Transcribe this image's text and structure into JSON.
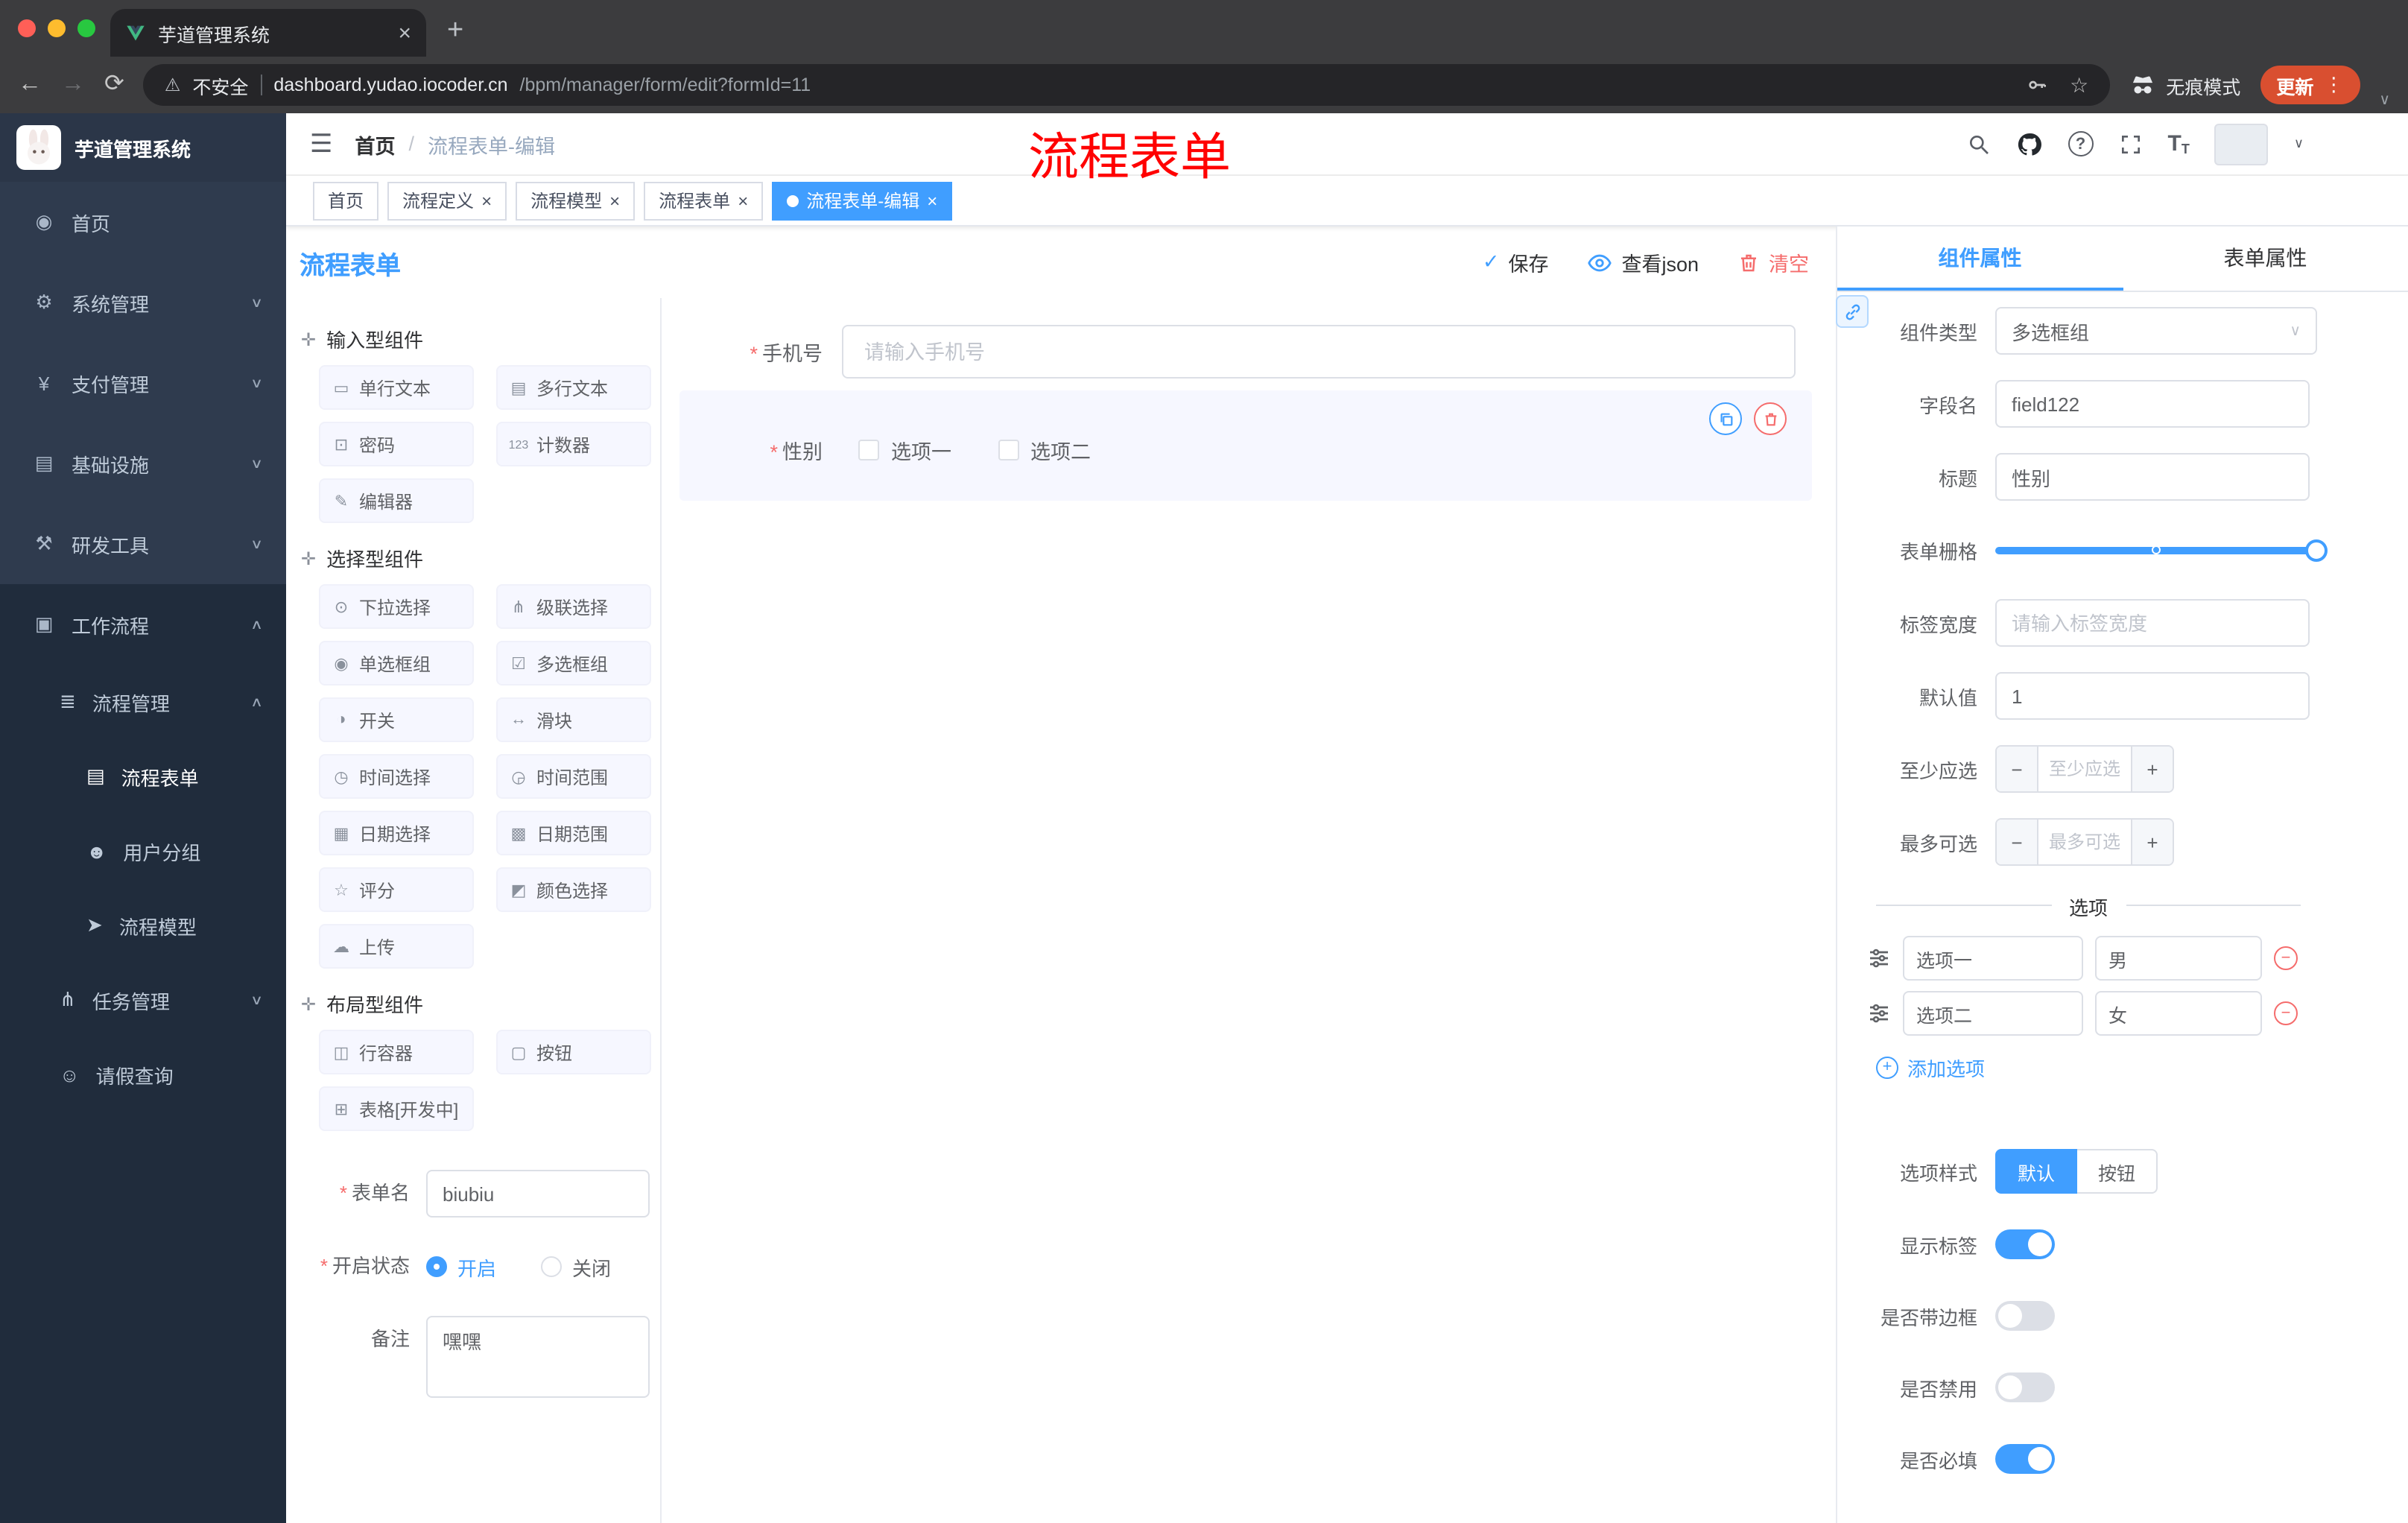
{
  "colors": {
    "primary": "#409eff",
    "danger": "#f56c6c",
    "sidebar_bg": "#2f3b4e",
    "sidebar_submenu_bg": "#202c3c",
    "update_pill": "#d94f30",
    "annotation": "#ff0000"
  },
  "icons": {
    "close": "×",
    "new_tab": "+",
    "back": "←",
    "forward": "→",
    "reload": "⟳",
    "warning": "⚠",
    "star": "☆",
    "kebab": "⋮",
    "caret_down": "∨",
    "chevron_up": "∧",
    "chevron_down": "∨",
    "hamburger": "☰",
    "slash": "/",
    "question": "?",
    "check": "✓",
    "minus": "−",
    "plus": "+",
    "asterisk": "*",
    "font_size": "T"
  },
  "browser": {
    "tab_title": "芋道管理系统",
    "security_label": "不安全",
    "url_host": "dashboard.yudao.iocoder.cn",
    "url_path": "/bpm/manager/form/edit?formId=11",
    "incognito_label": "无痕模式",
    "update_label": "更新"
  },
  "annotation": {
    "text": "流程表单"
  },
  "sidebar": {
    "logo_title": "芋道管理系统",
    "items": [
      {
        "label": "首页",
        "glyph": "◉"
      },
      {
        "label": "系统管理",
        "glyph": "⚙"
      },
      {
        "label": "支付管理",
        "glyph": "¥"
      },
      {
        "label": "基础设施",
        "glyph": "▤"
      },
      {
        "label": "研发工具",
        "glyph": "⚒"
      }
    ],
    "workflow": {
      "label": "工作流程",
      "glyph": "▣",
      "submenu": [
        {
          "label": "流程管理",
          "glyph": "≣"
        },
        {
          "label": "流程表单",
          "glyph": "▤"
        },
        {
          "label": "用户分组",
          "glyph": "☻"
        },
        {
          "label": "流程模型",
          "glyph": "➤"
        },
        {
          "label": "任务管理",
          "glyph": "⋔"
        },
        {
          "label": "请假查询",
          "glyph": "☺"
        }
      ]
    }
  },
  "header": {
    "breadcrumb": [
      "首页",
      "流程表单-编辑"
    ]
  },
  "tags": [
    {
      "label": "首页"
    },
    {
      "label": "流程定义"
    },
    {
      "label": "流程模型"
    },
    {
      "label": "流程表单"
    },
    {
      "label": "流程表单-编辑"
    }
  ],
  "designer": {
    "title": "流程表单",
    "actions": {
      "save": "保存",
      "view_json": "查看json",
      "clear": "清空"
    },
    "groups": [
      {
        "title": "输入型组件",
        "glyph": "✛",
        "items": [
          {
            "label": "单行文本",
            "glyph": "▭"
          },
          {
            "label": "多行文本",
            "glyph": "▤"
          },
          {
            "label": "密码",
            "glyph": "⊡"
          },
          {
            "label": "计数器",
            "glyph": "123"
          },
          {
            "label": "编辑器",
            "glyph": "✎"
          }
        ]
      },
      {
        "title": "选择型组件",
        "glyph": "✛",
        "items": [
          {
            "label": "下拉选择",
            "glyph": "⊙"
          },
          {
            "label": "级联选择",
            "glyph": "⋔"
          },
          {
            "label": "单选框组",
            "glyph": "◉"
          },
          {
            "label": "多选框组",
            "glyph": "☑"
          },
          {
            "label": "开关",
            "glyph": "◑"
          },
          {
            "label": "滑块",
            "glyph": "↔"
          },
          {
            "label": "时间选择",
            "glyph": "◷"
          },
          {
            "label": "时间范围",
            "glyph": "◶"
          },
          {
            "label": "日期选择",
            "glyph": "▦"
          },
          {
            "label": "日期范围",
            "glyph": "▩"
          },
          {
            "label": "评分",
            "glyph": "☆"
          },
          {
            "label": "颜色选择",
            "glyph": "◩"
          },
          {
            "label": "上传",
            "glyph": "☁"
          }
        ]
      },
      {
        "title": "布局型组件",
        "glyph": "✛",
        "items": [
          {
            "label": "行容器",
            "glyph": "◫"
          },
          {
            "label": "按钮",
            "glyph": "▢"
          },
          {
            "label": "表格[开发中]",
            "glyph": "⊞"
          }
        ]
      }
    ],
    "meta": {
      "form_name_label": "表单名",
      "form_name_value": "biubiu",
      "status_label": "开启状态",
      "status_on": "开启",
      "status_off": "关闭",
      "remark_label": "备注",
      "remark_value": "嘿嘿"
    }
  },
  "canvas": {
    "phone": {
      "label": "手机号",
      "placeholder": "请输入手机号"
    },
    "gender": {
      "label": "性别",
      "options": [
        "选项一",
        "选项二"
      ]
    }
  },
  "inspector": {
    "tabs": [
      "组件属性",
      "表单属性"
    ],
    "rows": {
      "component_type": {
        "label": "组件类型",
        "value": "多选框组"
      },
      "field_name": {
        "label": "字段名",
        "value": "field122"
      },
      "title": {
        "label": "标题",
        "value": "性别"
      },
      "form_grid": {
        "label": "表单栅格"
      },
      "label_width": {
        "label": "标签宽度",
        "placeholder": "请输入标签宽度"
      },
      "default_value": {
        "label": "默认值",
        "value": "1"
      },
      "min_select": {
        "label": "至少应选",
        "placeholder": "至少应选"
      },
      "max_select": {
        "label": "最多可选",
        "placeholder": "最多可选"
      }
    },
    "options_section": {
      "title": "选项",
      "options": [
        {
          "label": "选项一",
          "value": "男"
        },
        {
          "label": "选项二",
          "value": "女"
        }
      ],
      "add_label": "添加选项"
    },
    "style_row": {
      "label": "选项样式",
      "choices": [
        "默认",
        "按钮"
      ]
    },
    "toggles": [
      {
        "label": "显示标签",
        "on": true
      },
      {
        "label": "是否带边框",
        "on": false
      },
      {
        "label": "是否禁用",
        "on": false
      },
      {
        "label": "是否必填",
        "on": true
      }
    ]
  }
}
